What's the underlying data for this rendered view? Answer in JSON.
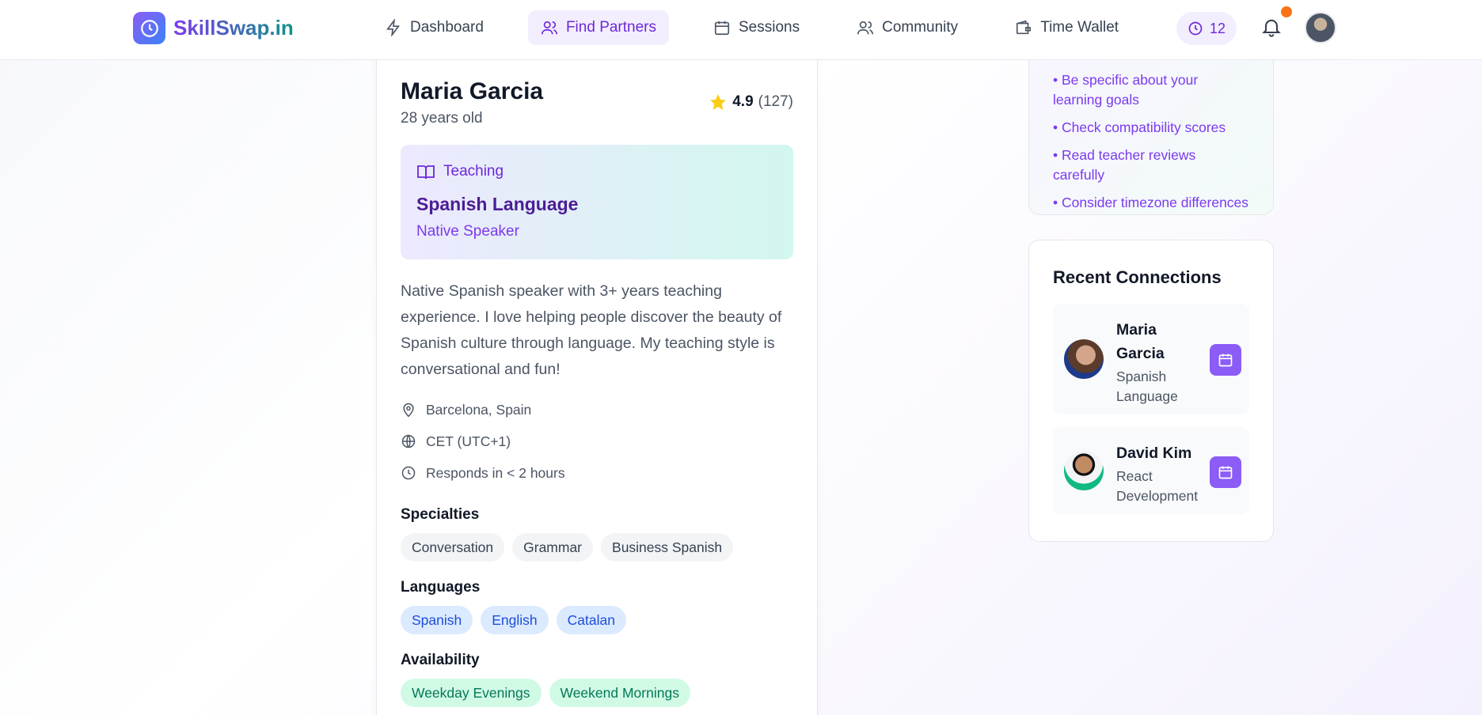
{
  "app": {
    "name": "SkillSwap.in"
  },
  "nav": {
    "items": [
      {
        "label": "Dashboard",
        "icon": "bolt-icon"
      },
      {
        "label": "Find Partners",
        "icon": "users-icon",
        "active": true
      },
      {
        "label": "Sessions",
        "icon": "calendar-icon"
      },
      {
        "label": "Community",
        "icon": "users-icon"
      },
      {
        "label": "Time Wallet",
        "icon": "wallet-icon"
      }
    ],
    "credits": "12"
  },
  "profile": {
    "name": "Maria Garcia",
    "age": "28 years old",
    "rating": "4.9",
    "reviews": "(127)",
    "teaching_label": "Teaching",
    "skill": "Spanish Language",
    "level": "Native Speaker",
    "bio": "Native Spanish speaker with 3+ years teaching experience. I love helping people discover the beauty of Spanish culture through language. My teaching style is conversational and fun!",
    "location": "Barcelona, Spain",
    "timezone": "CET (UTC+1)",
    "response": "Responds in < 2 hours",
    "specialties_title": "Specialties",
    "specialties": [
      "Conversation",
      "Grammar",
      "Business Spanish"
    ],
    "languages_title": "Languages",
    "languages": [
      "Spanish",
      "English",
      "Catalan"
    ],
    "availability_title": "Availability",
    "availability": [
      "Weekday Evenings",
      "Weekend Mornings"
    ]
  },
  "tips": [
    "• Be specific about your learning goals",
    "• Check compatibility scores",
    "• Read teacher reviews carefully",
    "• Consider timezone differences"
  ],
  "connections": {
    "title": "Recent Connections",
    "items": [
      {
        "name": "Maria Garcia",
        "skill": "Spanish Language"
      },
      {
        "name": "David Kim",
        "skill": "React Development"
      }
    ]
  },
  "colors": {
    "accent": "#8b5cf6",
    "accent_text": "#6d28d9",
    "notification": "#f97316"
  }
}
